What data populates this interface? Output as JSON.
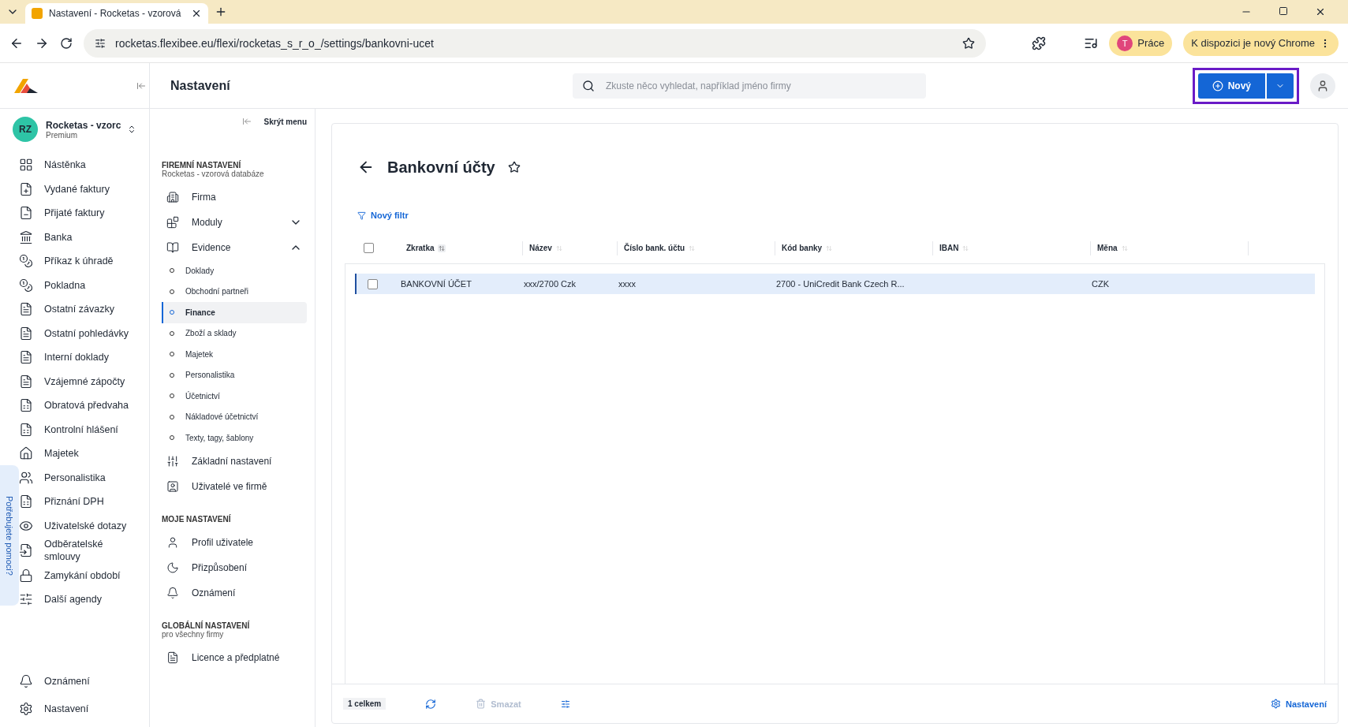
{
  "browser": {
    "tab_title": "Nastavení - Rocketas - vzorová",
    "url": "rocketas.flexibee.eu/flexi/rocketas_s_r_o_/settings/bankovni-ucet",
    "profile_initial": "T",
    "profile_name": "Práce",
    "update_label": "K dispozici je nový Chrome"
  },
  "header": {
    "title": "Nastavení",
    "search_placeholder": "Zkuste něco vyhledat, například jméno firmy",
    "new_button": "Nový"
  },
  "company": {
    "initials": "RZ",
    "name": "Rocketas - vzorc",
    "plan": "Premium"
  },
  "sidebar": {
    "items": [
      {
        "label": "Nástěnka"
      },
      {
        "label": "Vydané faktury"
      },
      {
        "label": "Přijaté faktury"
      },
      {
        "label": "Banka"
      },
      {
        "label": "Příkaz k úhradě"
      },
      {
        "label": "Pokladna"
      },
      {
        "label": "Ostatní závazky"
      },
      {
        "label": "Ostatní pohledávky"
      },
      {
        "label": "Interní doklady"
      },
      {
        "label": "Vzájemné zápočty"
      },
      {
        "label": "Obratová předvaha"
      },
      {
        "label": "Kontrolní hlášení"
      },
      {
        "label": "Majetek"
      },
      {
        "label": "Personalistika"
      },
      {
        "label": "Přiznání DPH"
      },
      {
        "label": "Uživatelské dotazy"
      },
      {
        "label": "Odběratelské smlouvy"
      },
      {
        "label": "Zamykání období"
      },
      {
        "label": "Další agendy"
      }
    ],
    "bottom_items": [
      {
        "label": "Oznámení"
      },
      {
        "label": "Nastavení"
      }
    ],
    "help_tab": "Potřebujete pomoci?"
  },
  "settings_menu": {
    "hide_label": "Skrýt menu",
    "sections": [
      {
        "title": "FIREMNÍ NASTAVENÍ",
        "subtitle": "Rocketas - vzorová databáze",
        "items": [
          {
            "label": "Firma"
          },
          {
            "label": "Moduly",
            "expanded": false
          },
          {
            "label": "Evidence",
            "expanded": true,
            "children": [
              {
                "label": "Doklady",
                "selected": false
              },
              {
                "label": "Obchodní partneři",
                "selected": false
              },
              {
                "label": "Finance",
                "selected": true
              },
              {
                "label": "Zboží a sklady",
                "selected": false
              },
              {
                "label": "Majetek",
                "selected": false
              },
              {
                "label": "Personalistika",
                "selected": false
              },
              {
                "label": "Účetnictví",
                "selected": false
              },
              {
                "label": "Nákladové účetnictví",
                "selected": false
              },
              {
                "label": "Texty, tagy, šablony",
                "selected": false
              }
            ]
          },
          {
            "label": "Základní nastavení"
          },
          {
            "label": "Uživatelé ve firmě"
          }
        ]
      },
      {
        "title": "MOJE NASTAVENÍ",
        "items": [
          {
            "label": "Profil uživatele"
          },
          {
            "label": "Přizpůsobení"
          },
          {
            "label": "Oznámení"
          }
        ]
      },
      {
        "title": "GLOBÁLNÍ NASTAVENÍ",
        "subtitle": "pro všechny firmy",
        "items": [
          {
            "label": "Licence a předplatné"
          }
        ]
      }
    ]
  },
  "page": {
    "title": "Bankovní účty",
    "filter_label": "Nový filtr",
    "table": {
      "select_all_checked": false,
      "columns": [
        {
          "label": "Zkratka",
          "sorted": true
        },
        {
          "label": "Název",
          "sorted": false
        },
        {
          "label": "Číslo bank. účtu",
          "sorted": false
        },
        {
          "label": "Kód banky",
          "sorted": false
        },
        {
          "label": "IBAN",
          "sorted": false
        },
        {
          "label": "Měna",
          "sorted": false
        }
      ],
      "rows": [
        {
          "selected": true,
          "checked": false,
          "cells": [
            "BANKOVNÍ ÚČET",
            "xxx/2700 Czk",
            "xxxx",
            "2700 - UniCredit Bank Czech R...",
            "",
            "CZK"
          ]
        }
      ]
    },
    "footer": {
      "count": "1 celkem",
      "delete_label": "Smazat",
      "settings_label": "Nastavení"
    }
  }
}
